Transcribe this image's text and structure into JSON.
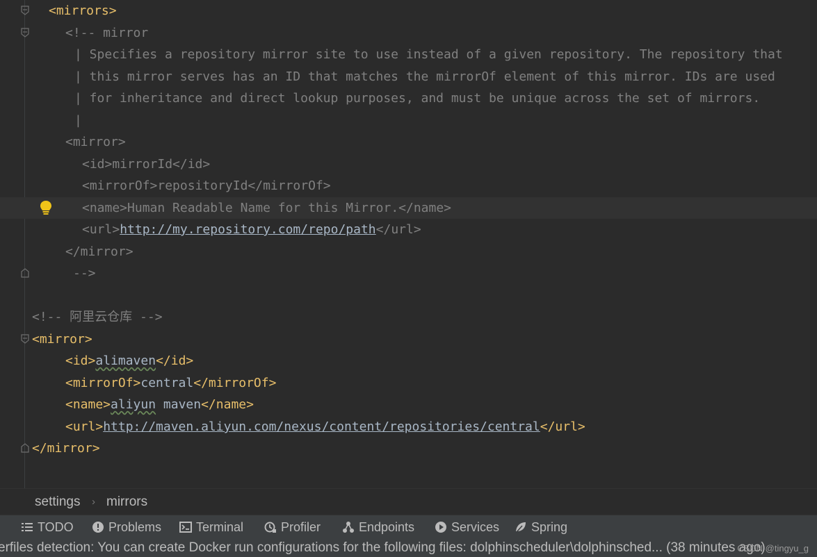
{
  "editor": {
    "lines": [
      {
        "id": "l1",
        "parts": [
          {
            "c": "tag",
            "t": "<mirrors>"
          }
        ]
      },
      {
        "id": "l2",
        "parts": [
          {
            "c": "cmt",
            "t": "<!-- mirror"
          }
        ]
      },
      {
        "id": "l3",
        "parts": [
          {
            "c": "cmt",
            "t": "| Specifies a repository mirror site to use instead of a given repository. The repository that"
          }
        ]
      },
      {
        "id": "l4",
        "parts": [
          {
            "c": "cmt",
            "t": "| this mirror serves has an ID that matches the mirrorOf element of this mirror. IDs are used"
          }
        ]
      },
      {
        "id": "l5",
        "parts": [
          {
            "c": "cmt",
            "t": "| for inheritance and direct lookup purposes, and must be unique across the set of mirrors."
          }
        ]
      },
      {
        "id": "l6",
        "parts": [
          {
            "c": "cmt",
            "t": "|"
          }
        ]
      },
      {
        "id": "l7",
        "parts": [
          {
            "c": "cmt",
            "t": "<mirror>"
          }
        ]
      },
      {
        "id": "l8",
        "parts": [
          {
            "c": "cmt",
            "t": "<id>mirrorId</id>"
          }
        ]
      },
      {
        "id": "l9",
        "parts": [
          {
            "c": "cmt",
            "t": "<mirrorOf>repositoryId</mirrorOf>"
          }
        ]
      },
      {
        "id": "l10",
        "parts": [
          {
            "c": "cmt",
            "t": "<name>Human Readable Name for this Mirror.</name>"
          }
        ]
      },
      {
        "id": "l11",
        "parts": [
          {
            "c": "cmt",
            "t": "<url>"
          },
          {
            "c": "cmt link",
            "t": "http://my.repository.com/repo/path"
          },
          {
            "c": "cmt",
            "t": "</url>"
          }
        ]
      },
      {
        "id": "l12",
        "parts": [
          {
            "c": "cmt",
            "t": "</mirror>"
          }
        ]
      },
      {
        "id": "l13",
        "parts": [
          {
            "c": "cmt",
            "t": "-->"
          }
        ]
      },
      {
        "id": "l14",
        "parts": []
      },
      {
        "id": "l15",
        "parts": [
          {
            "c": "cmt",
            "t": "<!-- 阿里云仓库 -->"
          }
        ]
      },
      {
        "id": "l16",
        "parts": [
          {
            "c": "tag",
            "t": "<mirror>"
          }
        ]
      },
      {
        "id": "l17",
        "parts": [
          {
            "c": "tag",
            "t": "<id>"
          },
          {
            "c": "txt squig",
            "t": "alimaven"
          },
          {
            "c": "tag",
            "t": "</id>"
          }
        ]
      },
      {
        "id": "l18",
        "parts": [
          {
            "c": "tag",
            "t": "<mirrorOf>"
          },
          {
            "c": "txt",
            "t": "central"
          },
          {
            "c": "tag",
            "t": "</mirrorOf>"
          }
        ]
      },
      {
        "id": "l19",
        "parts": [
          {
            "c": "tag",
            "t": "<name>"
          },
          {
            "c": "txt squig",
            "t": "aliyun"
          },
          {
            "c": "txt",
            "t": " maven"
          },
          {
            "c": "tag",
            "t": "</name>"
          }
        ]
      },
      {
        "id": "l20",
        "parts": [
          {
            "c": "tag",
            "t": "<url>"
          },
          {
            "c": "link",
            "t": "http://maven.aliyun.com/nexus/content/repositories/central"
          },
          {
            "c": "tag",
            "t": "</url>"
          }
        ]
      },
      {
        "id": "l21",
        "parts": [
          {
            "c": "tag",
            "t": "</mirror>"
          }
        ]
      }
    ]
  },
  "breadcrumb": {
    "items": [
      "settings",
      "mirrors"
    ],
    "separator": "›"
  },
  "toolbar": {
    "items": [
      {
        "label": "TODO",
        "icon": "list-icon"
      },
      {
        "label": "Problems",
        "icon": "alert-circle-icon"
      },
      {
        "label": "Terminal",
        "icon": "terminal-icon"
      },
      {
        "label": "Profiler",
        "icon": "profiler-icon"
      },
      {
        "label": "Endpoints",
        "icon": "endpoints-icon"
      },
      {
        "label": "Services",
        "icon": "services-icon"
      },
      {
        "label": "Spring",
        "icon": "spring-leaf-icon"
      }
    ]
  },
  "status": {
    "message": "erfiles detection: You can create Docker run configurations for the following files: dolphinscheduler\\dolphinsched... (38 minutes ago)",
    "watermark": "CSDN @tingyu_g"
  },
  "colors": {
    "background": "#2b2b2b",
    "tag": "#e8bf6a",
    "comment": "#808080",
    "text": "#a9b7c6",
    "panel": "#3c3f41"
  }
}
